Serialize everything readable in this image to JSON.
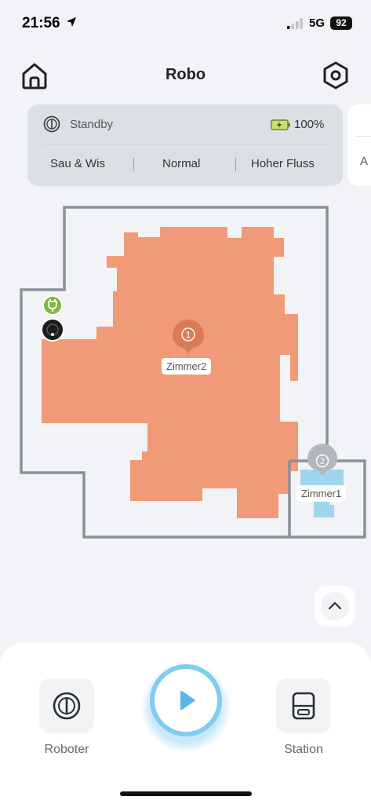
{
  "status_bar": {
    "time": "21:56",
    "network": "5G",
    "battery": "92"
  },
  "header": {
    "title": "Robo"
  },
  "robot_status": {
    "state": "Standby",
    "battery_percent": "100%"
  },
  "cleaning_modes": {
    "mode_1": "Sau & Wis",
    "mode_2": "Normal",
    "mode_3": "Hoher Fluss"
  },
  "side_card": {
    "letter": "A"
  },
  "map": {
    "rooms": [
      {
        "number": "1",
        "name": "Zimmer2",
        "color": "#f09a78"
      },
      {
        "number": "2",
        "name": "Zimmer1",
        "color": "#9fd6ef"
      }
    ],
    "wall_color": "#8a9099",
    "charger_color": "#7dbb3a"
  },
  "bottom_bar": {
    "robot_label": "Roboter",
    "station_label": "Station",
    "accent": "#5ab8e6"
  }
}
